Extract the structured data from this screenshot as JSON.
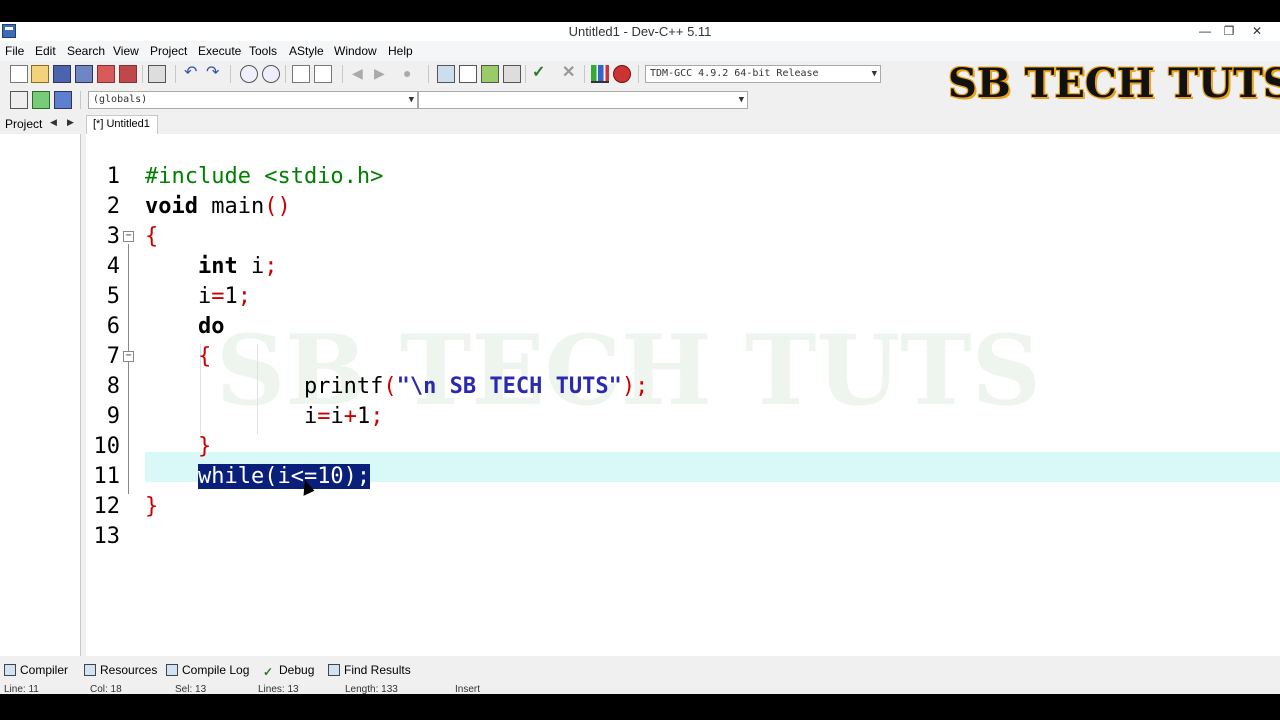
{
  "window": {
    "title": "Untitled1 - Dev-C++ 5.11"
  },
  "menu": [
    "File",
    "Edit",
    "Search",
    "View",
    "Project",
    "Execute",
    "Tools",
    "AStyle",
    "Window",
    "Help"
  ],
  "toolbar": {
    "compiler_select": "TDM-GCC 4.9.2 64-bit Release",
    "scope_select": "(globals)",
    "member_select": ""
  },
  "brand": "SB TECH TUTS",
  "watermark": "SB TECH TUTS",
  "project_tab": {
    "label": "Project"
  },
  "editor_tab": {
    "label": "[*] Untitled1"
  },
  "code": {
    "line_numbers": [
      "1",
      "2",
      "3",
      "4",
      "5",
      "6",
      "7",
      "8",
      "9",
      "10",
      "11",
      "12",
      "13"
    ],
    "lines": [
      {
        "tokens": [
          {
            "t": "#include <stdio.h>",
            "c": "pre"
          }
        ]
      },
      {
        "tokens": [
          {
            "t": "void",
            "c": "kw"
          },
          {
            "t": " main",
            "c": "blk"
          },
          {
            "t": "()",
            "c": "red"
          }
        ]
      },
      {
        "tokens": [
          {
            "t": "{",
            "c": "red"
          }
        ]
      },
      {
        "tokens": [
          {
            "t": "    ",
            "c": "blk"
          },
          {
            "t": "int",
            "c": "kw"
          },
          {
            "t": " i",
            "c": "blk"
          },
          {
            "t": ";",
            "c": "red"
          }
        ]
      },
      {
        "tokens": [
          {
            "t": "    i",
            "c": "blk"
          },
          {
            "t": "=",
            "c": "red"
          },
          {
            "t": "1",
            "c": "blk"
          },
          {
            "t": ";",
            "c": "red"
          }
        ]
      },
      {
        "tokens": [
          {
            "t": "    ",
            "c": "blk"
          },
          {
            "t": "do",
            "c": "kw"
          }
        ]
      },
      {
        "tokens": [
          {
            "t": "    ",
            "c": "blk"
          },
          {
            "t": "{",
            "c": "red"
          }
        ]
      },
      {
        "tokens": [
          {
            "t": "            printf",
            "c": "blk"
          },
          {
            "t": "(",
            "c": "red"
          },
          {
            "t": "\"\\n SB TECH TUTS\"",
            "c": "blue"
          },
          {
            "t": ");",
            "c": "red"
          }
        ]
      },
      {
        "tokens": [
          {
            "t": "            i",
            "c": "blk"
          },
          {
            "t": "=",
            "c": "red"
          },
          {
            "t": "i",
            "c": "blk"
          },
          {
            "t": "+",
            "c": "red"
          },
          {
            "t": "1",
            "c": "blk"
          },
          {
            "t": ";",
            "c": "red"
          }
        ]
      },
      {
        "tokens": [
          {
            "t": "    ",
            "c": "blk"
          },
          {
            "t": "}",
            "c": "red"
          }
        ]
      },
      {
        "tokens": [
          {
            "t": "    ",
            "c": "blk"
          },
          {
            "t": "while(i<=10);",
            "c": "sel"
          }
        ]
      },
      {
        "tokens": [
          {
            "t": "}",
            "c": "red"
          }
        ]
      },
      {
        "tokens": []
      }
    ]
  },
  "bottom_tabs": [
    "Compiler",
    "Resources",
    "Compile Log",
    "Debug",
    "Find Results"
  ],
  "status": {
    "line": "Line: 11",
    "col": "Col: 18",
    "sel": "Sel: 13",
    "lines": "Lines: 13",
    "length": "Length: 133",
    "mode": "Insert"
  }
}
